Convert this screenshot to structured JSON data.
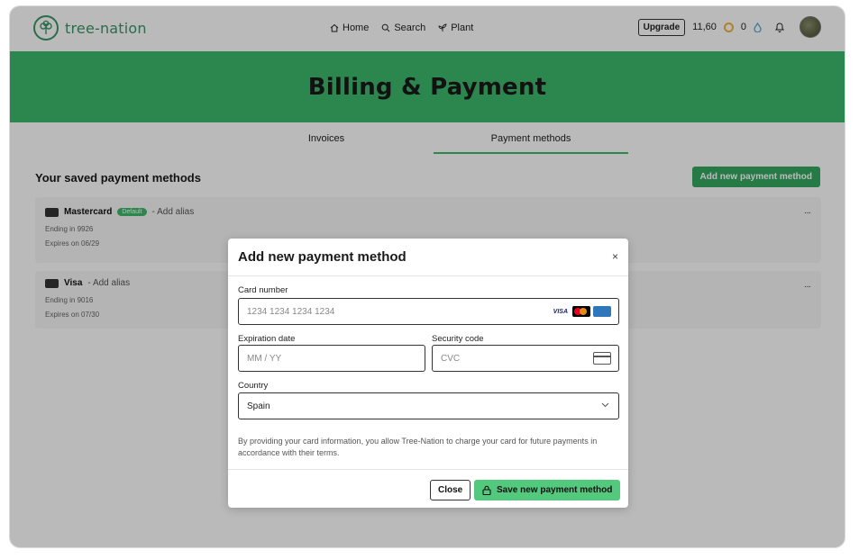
{
  "brand": {
    "name": "tree-nation"
  },
  "nav": [
    {
      "label": "Home",
      "icon": "home-icon"
    },
    {
      "label": "Search",
      "icon": "search-icon"
    },
    {
      "label": "Plant",
      "icon": "plant-icon"
    }
  ],
  "header": {
    "upgrade_label": "Upgrade",
    "balance": "11,60",
    "drops": "0",
    "icons": [
      "coin-icon",
      "drop-icon",
      "bell-icon",
      "avatar"
    ]
  },
  "page": {
    "title": "Billing & Payment",
    "tabs": [
      {
        "label": "Invoices",
        "active": false
      },
      {
        "label": "Payment methods",
        "active": true
      }
    ],
    "section_title": "Your saved payment methods",
    "add_button_label": "Add new payment method"
  },
  "saved_methods": [
    {
      "brand": "Mastercard",
      "default_badge": "Default",
      "alias_action": "- Add alias",
      "ending": "Ending in 9926",
      "expires": "Expires on 06/29",
      "menu": "···"
    },
    {
      "brand": "Visa",
      "alias_action": "- Add alias",
      "ending": "Ending in 9016",
      "expires": "Expires on 07/30",
      "menu": "···"
    }
  ],
  "modal": {
    "title": "Add new payment method",
    "close_icon": "×",
    "card_number": {
      "label": "Card number",
      "placeholder": "1234 1234 1234 1234",
      "visa_text": "VISA"
    },
    "expiration": {
      "label": "Expiration date",
      "placeholder": "MM / YY"
    },
    "security": {
      "label": "Security code",
      "placeholder": "CVC"
    },
    "country": {
      "label": "Country",
      "value": "Spain"
    },
    "disclaimer": "By providing your card information, you allow Tree-Nation to charge your card for future payments in accordance with their terms.",
    "close_button": "Close",
    "save_button": "Save new payment method"
  },
  "colors": {
    "brand_green": "#3cb96b",
    "button_green": "#34a860",
    "save_green": "#52c97c",
    "logo_green": "#3c9467"
  }
}
